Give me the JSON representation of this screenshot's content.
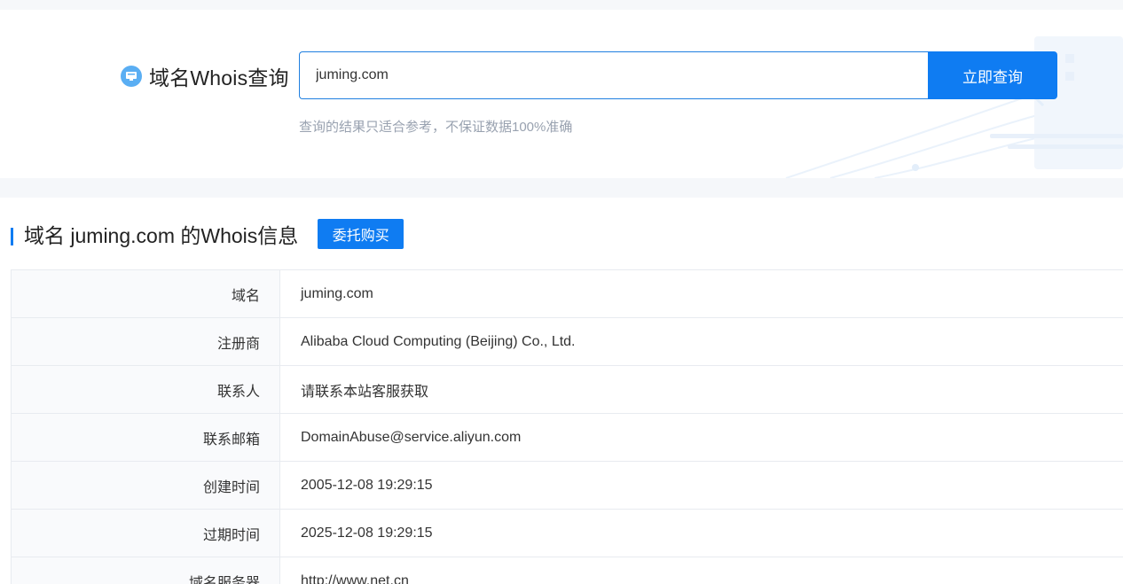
{
  "search": {
    "brand_title": "域名Whois查询",
    "input_value": "juming.com",
    "button_label": "立即查询",
    "disclaimer": "查询的结果只适合参考，不保证数据100%准确"
  },
  "result": {
    "title": "域名 juming.com 的Whois信息",
    "entrust_button_label": "委托购买",
    "rows": [
      {
        "label": "域名",
        "value": "juming.com"
      },
      {
        "label": "注册商",
        "value": "Alibaba Cloud Computing (Beijing) Co., Ltd."
      },
      {
        "label": "联系人",
        "value": "请联系本站客服获取"
      },
      {
        "label": "联系邮箱",
        "value": "DomainAbuse@service.aliyun.com"
      },
      {
        "label": "创建时间",
        "value": "2005-12-08 19:29:15"
      },
      {
        "label": "过期时间",
        "value": "2025-12-08 19:29:15"
      },
      {
        "label": "域名服务器",
        "value": "http://www.net.cn"
      }
    ]
  },
  "colors": {
    "accent": "#0f7cf2",
    "input_border": "#1f7fe0",
    "disclaimer_text": "#99a2b0",
    "label_bg": "#f9fafc"
  }
}
